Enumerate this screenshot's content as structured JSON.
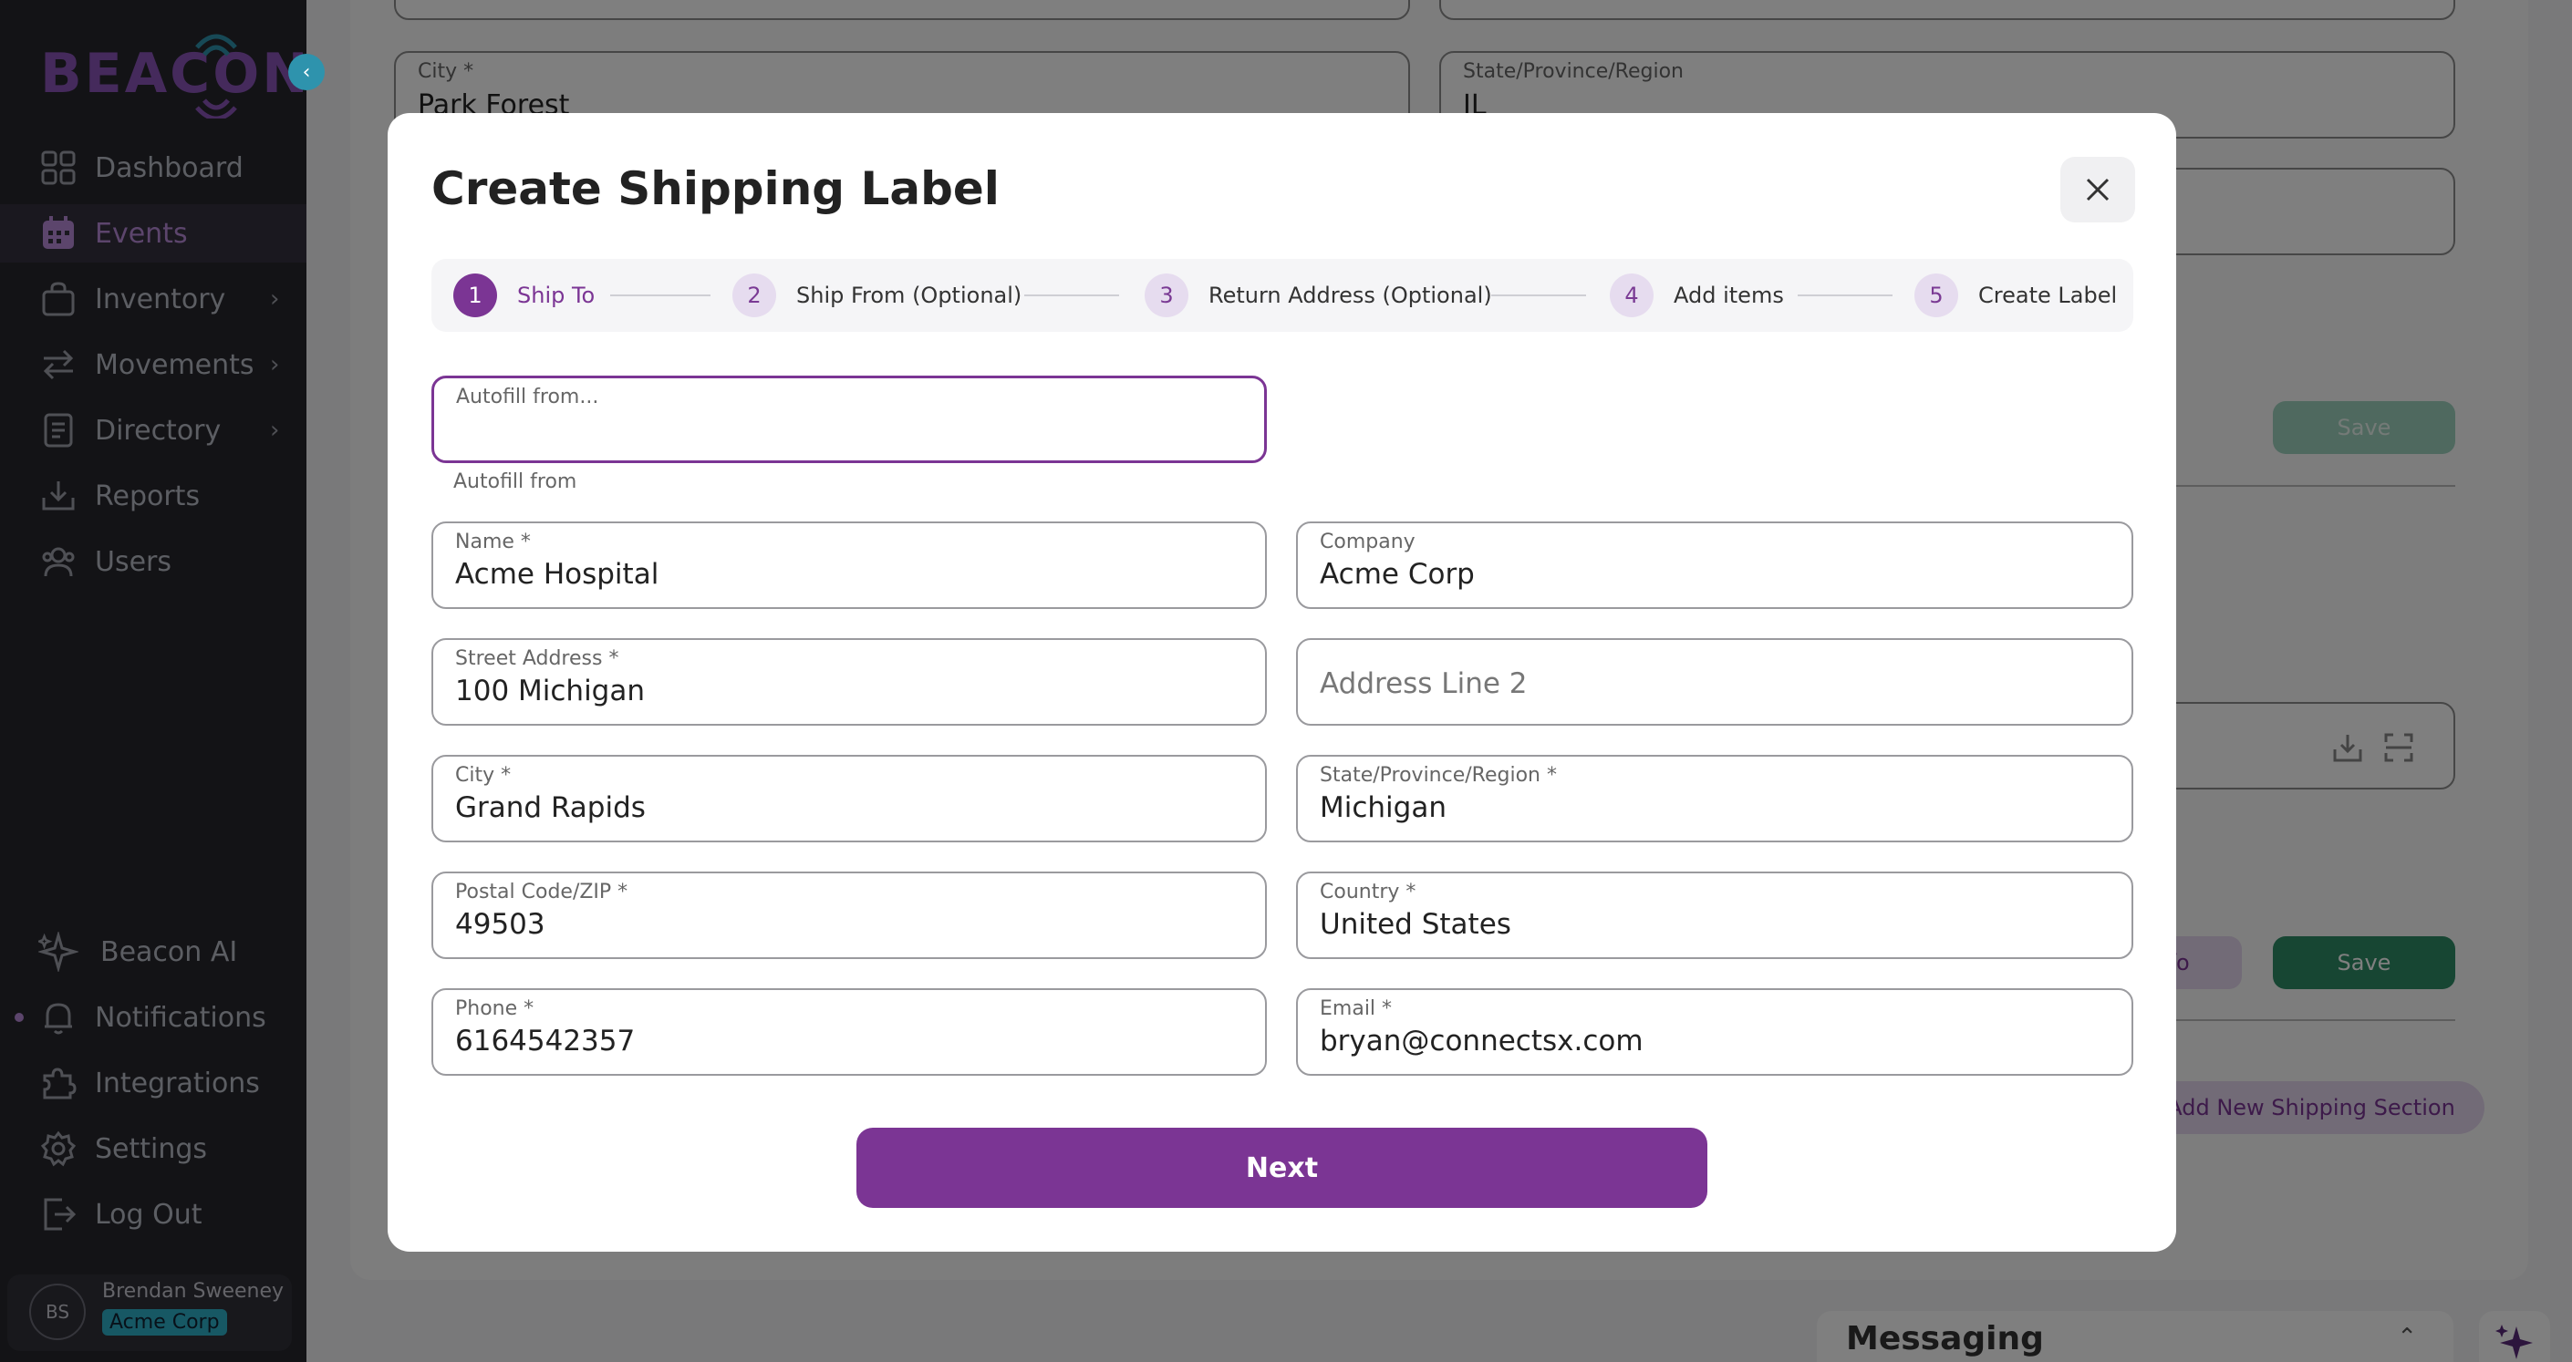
{
  "sidebar": {
    "brand": "BEACON",
    "nav": [
      {
        "label": "Dashboard",
        "icon": "grid-icon",
        "chevron": false,
        "active": false
      },
      {
        "label": "Events",
        "icon": "calendar-icon",
        "chevron": false,
        "active": true
      },
      {
        "label": "Inventory",
        "icon": "bag-icon",
        "chevron": true,
        "active": false
      },
      {
        "label": "Movements",
        "icon": "arrows-icon",
        "chevron": true,
        "active": false
      },
      {
        "label": "Directory",
        "icon": "document-icon",
        "chevron": true,
        "active": false
      },
      {
        "label": "Reports",
        "icon": "download-tray-icon",
        "chevron": false,
        "active": false
      },
      {
        "label": "Users",
        "icon": "users-icon",
        "chevron": false,
        "active": false
      }
    ],
    "bottom_nav": [
      {
        "label": "Beacon AI",
        "icon": "sparkle-icon"
      },
      {
        "label": "Notifications",
        "icon": "bell-icon"
      },
      {
        "label": "Integrations",
        "icon": "puzzle-icon"
      },
      {
        "label": "Settings",
        "icon": "gear-icon"
      },
      {
        "label": "Log Out",
        "icon": "logout-icon"
      }
    ],
    "user": {
      "initials": "BS",
      "name": "Brendan Sweeney",
      "org": "Acme Corp"
    },
    "chevron_glyph": "›"
  },
  "background": {
    "city_label": "City *",
    "city_value": "Park Forest",
    "state_label": "State/Province/Region",
    "state_value": "IL",
    "save_label": "Save",
    "info_label": "Info",
    "add_shipping_label": "Add New Shipping Section",
    "messaging_title": "Messaging"
  },
  "modal": {
    "title": "Create Shipping Label",
    "steps": [
      {
        "number": "1",
        "label": "Ship To"
      },
      {
        "number": "2",
        "label": "Ship From (Optional)"
      },
      {
        "number": "3",
        "label": "Return Address (Optional)"
      },
      {
        "number": "4",
        "label": "Add items"
      },
      {
        "number": "5",
        "label": "Create Label"
      }
    ],
    "autofill": {
      "label": "Autofill from...",
      "helper": "Autofill from",
      "value": ""
    },
    "fields": {
      "name": {
        "label": "Name *",
        "value": "Acme Hospital"
      },
      "company": {
        "label": "Company",
        "value": "Acme Corp"
      },
      "street": {
        "label": "Street Address *",
        "value": "100 Michigan"
      },
      "address2": {
        "placeholder": "Address Line 2"
      },
      "city": {
        "label": "City *",
        "value": "Grand Rapids"
      },
      "state": {
        "label": "State/Province/Region *",
        "value": "Michigan"
      },
      "postal": {
        "label": "Postal Code/ZIP *",
        "value": "49503"
      },
      "country": {
        "label": "Country *",
        "value": "United States"
      },
      "phone": {
        "label": "Phone *",
        "value": "6164542357"
      },
      "email": {
        "label": "Email *",
        "value": "bryan@connectsx.com"
      }
    },
    "next_label": "Next"
  },
  "colors": {
    "primary": "#7b3594",
    "sidebar": "#26262c",
    "accent_teal": "#2e93ad",
    "save_green": "#2e8c66"
  }
}
